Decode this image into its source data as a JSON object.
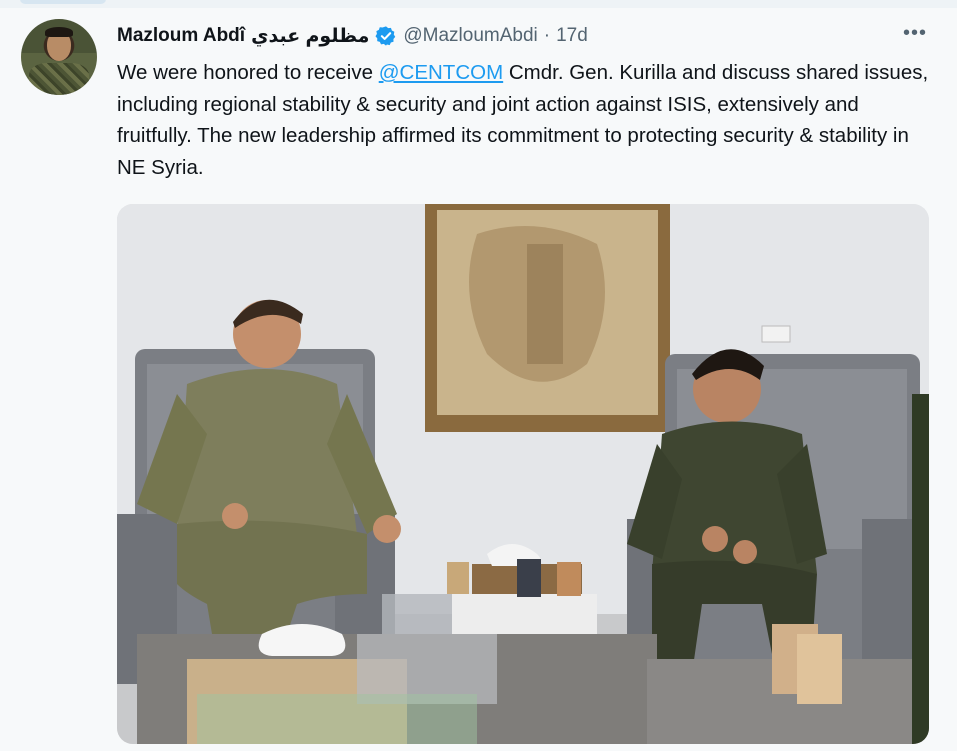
{
  "tweet": {
    "author_name": "Mazloum Abdî",
    "author_name_arabic": "مظلوم عبدي",
    "handle": "@MazloumAbdi",
    "separator": "·",
    "time": "17d",
    "more_label": "•••",
    "text_before": "We were honored to receive ",
    "mention": "@CENTCOM",
    "text_after": " Cmdr. Gen. Kurilla and discuss shared issues, including regional stability & security and joint action against ISIS, extensively and fruitfully. The new leadership affirmed its commitment to protecting security & stability in NE Syria.",
    "accent_color": "#1d9bf0",
    "verified_icon": "verified-badge-icon",
    "more_icon": "more-options-icon"
  }
}
